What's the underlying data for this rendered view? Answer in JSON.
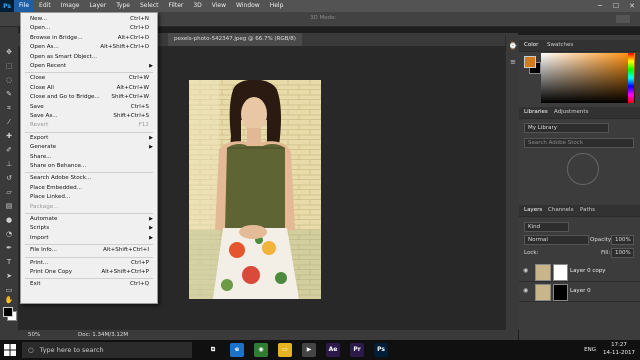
{
  "menubar": {
    "logo": "Ps",
    "items": [
      "File",
      "Edit",
      "Image",
      "Layer",
      "Type",
      "Select",
      "Filter",
      "3D",
      "View",
      "Window",
      "Help"
    ],
    "window_controls": [
      "─",
      "☐",
      "✕"
    ]
  },
  "options_bar": {
    "mode_3d": "3D Mode:"
  },
  "document": {
    "tab_title": "pexels-photo-542347.jpeg @ 66.7% (RGB/8)"
  },
  "status": {
    "zoom": "50%",
    "doc_size": "Doc: 1.34M/3.12M"
  },
  "file_menu": {
    "items": [
      {
        "label": "New...",
        "shortcut": "Ctrl+N"
      },
      {
        "label": "Open...",
        "shortcut": "Ctrl+O"
      },
      {
        "label": "Browse in Bridge...",
        "shortcut": "Alt+Ctrl+O"
      },
      {
        "label": "Open As...",
        "shortcut": "Alt+Shift+Ctrl+O"
      },
      {
        "label": "Open as Smart Object...",
        "shortcut": ""
      },
      {
        "label": "Open Recent",
        "shortcut": "",
        "submenu": true
      },
      {
        "separator": true
      },
      {
        "label": "Close",
        "shortcut": "Ctrl+W"
      },
      {
        "label": "Close All",
        "shortcut": "Alt+Ctrl+W"
      },
      {
        "label": "Close and Go to Bridge...",
        "shortcut": "Shift+Ctrl+W"
      },
      {
        "label": "Save",
        "shortcut": "Ctrl+S"
      },
      {
        "label": "Save As...",
        "shortcut": "Shift+Ctrl+S"
      },
      {
        "label": "Revert",
        "shortcut": "F12",
        "disabled": true
      },
      {
        "separator": true
      },
      {
        "label": "Export",
        "shortcut": "",
        "submenu": true
      },
      {
        "label": "Generate",
        "shortcut": "",
        "submenu": true
      },
      {
        "label": "Share...",
        "shortcut": ""
      },
      {
        "label": "Share on Behance...",
        "shortcut": ""
      },
      {
        "separator": true
      },
      {
        "label": "Search Adobe Stock...",
        "shortcut": ""
      },
      {
        "label": "Place Embedded...",
        "shortcut": ""
      },
      {
        "label": "Place Linked...",
        "shortcut": ""
      },
      {
        "label": "Package...",
        "shortcut": "",
        "disabled": true
      },
      {
        "separator": true
      },
      {
        "label": "Automate",
        "shortcut": "",
        "submenu": true
      },
      {
        "label": "Scripts",
        "shortcut": "",
        "submenu": true
      },
      {
        "label": "Import",
        "shortcut": "",
        "submenu": true
      },
      {
        "separator": true
      },
      {
        "label": "File Info...",
        "shortcut": "Alt+Shift+Ctrl+I"
      },
      {
        "separator": true
      },
      {
        "label": "Print...",
        "shortcut": "Ctrl+P"
      },
      {
        "label": "Print One Copy",
        "shortcut": "Alt+Shift+Ctrl+P"
      },
      {
        "separator": true
      },
      {
        "label": "Exit",
        "shortcut": "Ctrl+Q"
      }
    ]
  },
  "color_panel": {
    "tabs": [
      "Color",
      "Swatches"
    ],
    "fg_color": "#d47a1a",
    "bg_color": "#000000"
  },
  "libraries_panel": {
    "tabs": [
      "Libraries",
      "Adjustments"
    ],
    "library": "My Library",
    "search_placeholder": "Search Adobe Stock"
  },
  "layers_panel": {
    "tabs": [
      "Layers",
      "Channels",
      "Paths"
    ],
    "filter": "Kind",
    "blend_mode": "Normal",
    "opacity_label": "Opacity:",
    "opacity": "100%",
    "lock_label": "Lock:",
    "fill_label": "Fill:",
    "fill": "100%",
    "layers": [
      {
        "name": "Layer 0 copy",
        "mask": "white"
      },
      {
        "name": "Layer 0",
        "mask": "dark"
      }
    ]
  },
  "taskbar": {
    "search_placeholder": "Type here to search",
    "apps": [
      {
        "name": "task-view",
        "label": "⧉",
        "color": "#101010"
      },
      {
        "name": "edge",
        "label": "e",
        "color": "#1a73c8"
      },
      {
        "name": "chrome",
        "label": "◉",
        "color": "#2e7d32"
      },
      {
        "name": "explorer",
        "label": "▭",
        "color": "#e6b422"
      },
      {
        "name": "media",
        "label": "▶",
        "color": "#444"
      },
      {
        "name": "after-effects",
        "label": "Ae",
        "color": "#2b1a4a"
      },
      {
        "name": "premiere",
        "label": "Pr",
        "color": "#2b1a4a"
      },
      {
        "name": "photoshop",
        "label": "Ps",
        "color": "#001e36"
      }
    ],
    "language": "ENG",
    "time": "17:27",
    "date": "14-11-2017"
  }
}
